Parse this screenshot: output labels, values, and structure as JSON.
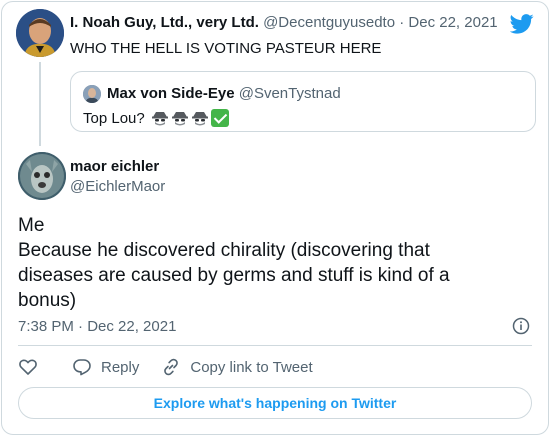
{
  "parent_tweet": {
    "name": "I. Noah Guy, Ltd., very Ltd.",
    "handle": "@Decentguyusedto",
    "separator": "·",
    "date": "Dec 22, 2021",
    "text": "WHO THE HELL IS VOTING PASTEUR HERE"
  },
  "quoted_tweet": {
    "name": "Max von Side-Eye",
    "handle": "@SvenTystnad",
    "text": "Top Lou?"
  },
  "main_tweet": {
    "name": "maor eichler",
    "handle": "@EichlerMaor",
    "lines": [
      "Me",
      "Because he discovered chirality (discovering that",
      "diseases are caused by germs and stuff is kind of a",
      "bonus)"
    ],
    "timestamp": "7:38 PM · Dec 22, 2021"
  },
  "actions": {
    "reply_label": "Reply",
    "copy_label": "Copy link to Tweet"
  },
  "explore": {
    "label": "Explore what's happening on Twitter"
  },
  "colors": {
    "accent": "#1d9bf0",
    "border": "#cfd9de",
    "muted": "#536471",
    "text": "#0f1419"
  },
  "icons": [
    "twitter-bird-icon",
    "spy-emoji-icon",
    "check-mark-emoji-icon",
    "info-icon",
    "heart-icon",
    "reply-icon",
    "link-icon"
  ]
}
